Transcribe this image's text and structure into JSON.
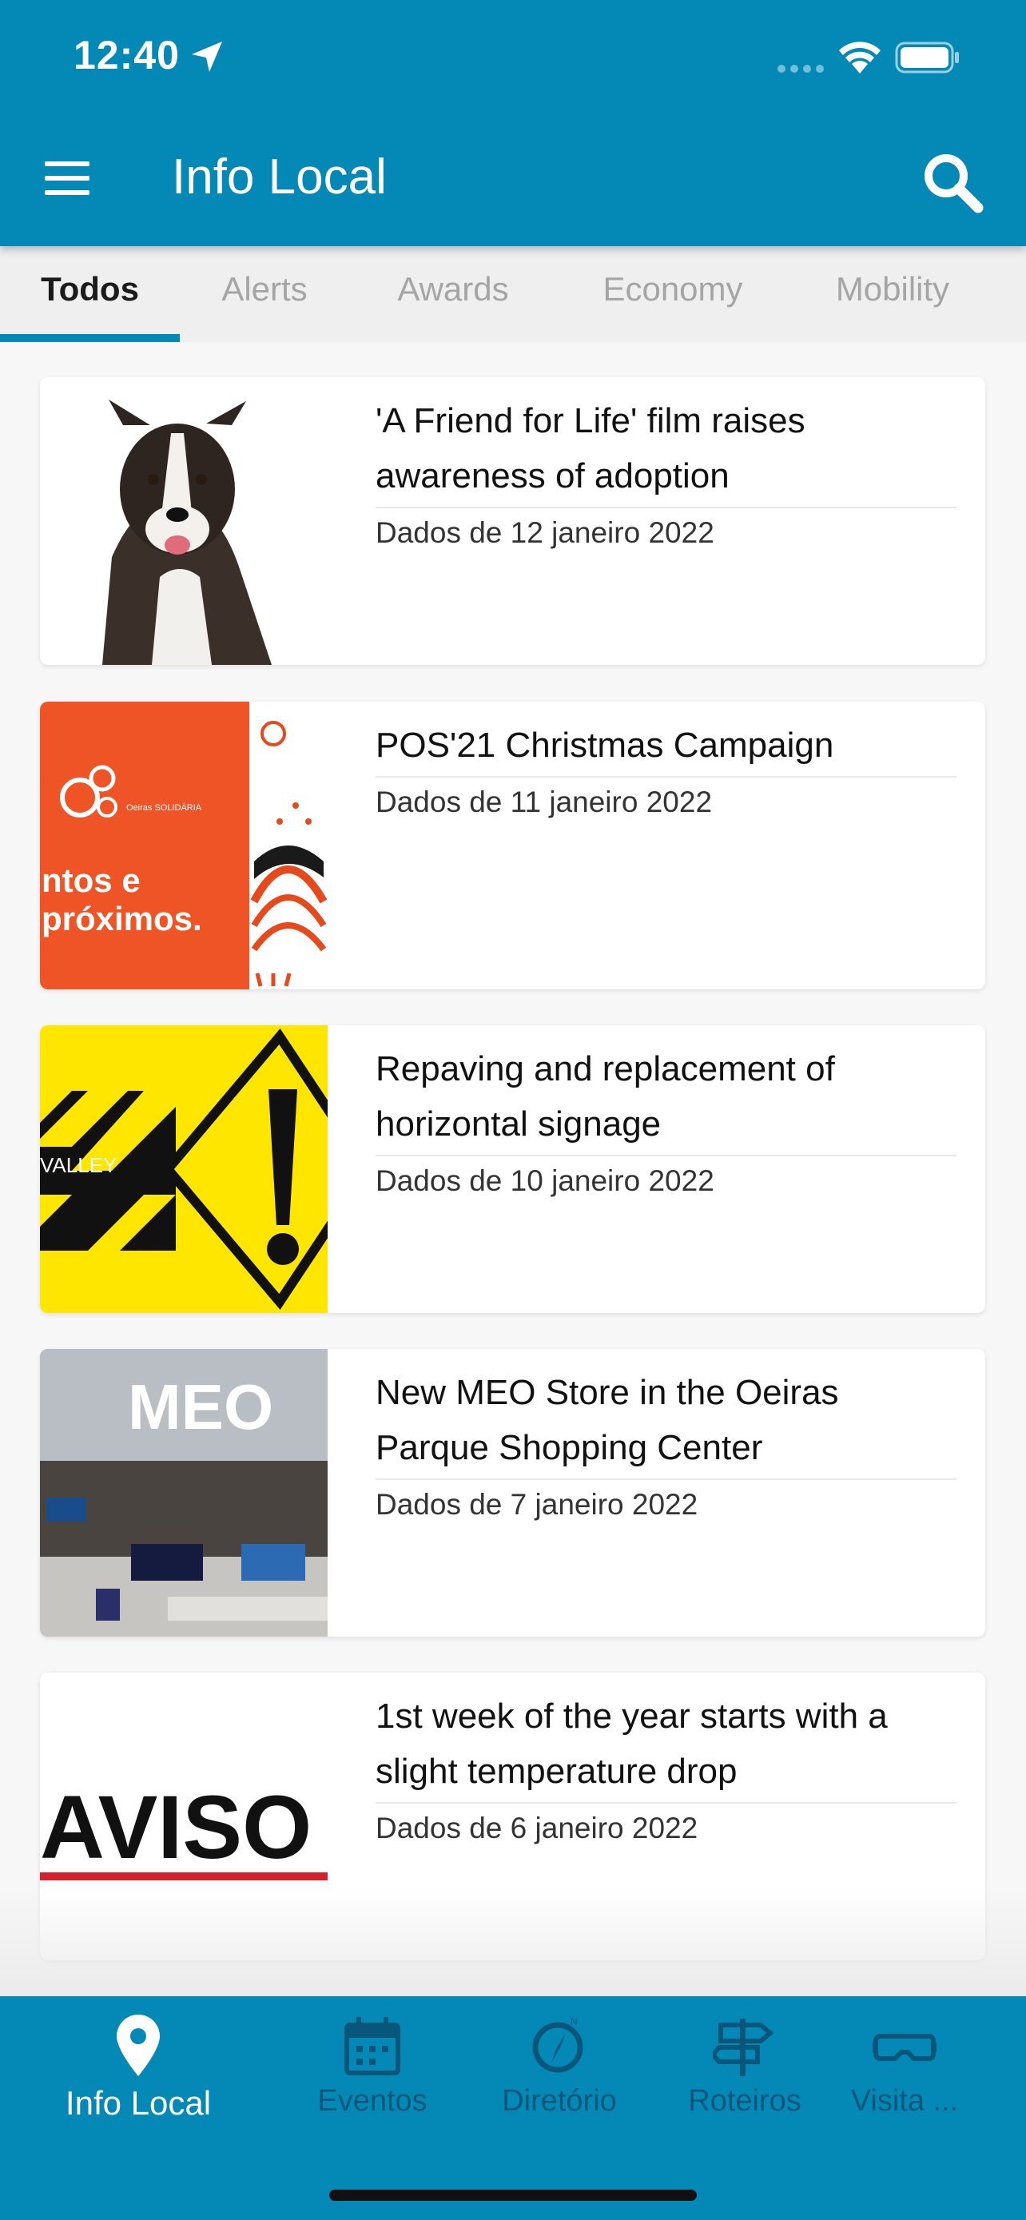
{
  "status_bar": {
    "time": "12:40"
  },
  "header": {
    "title": "Info Local"
  },
  "tabs": [
    {
      "label": "Todos",
      "active": true
    },
    {
      "label": "Alerts",
      "active": false
    },
    {
      "label": "Awards",
      "active": false
    },
    {
      "label": "Economy",
      "active": false
    },
    {
      "label": "Mobility",
      "active": false
    }
  ],
  "articles": [
    {
      "title": "'A Friend for Life' film raises awareness of adoption",
      "date": "Dados de 12 janeiro 2022"
    },
    {
      "title": "POS'21 Christmas Campaign",
      "date": "Dados de 11 janeiro 2022"
    },
    {
      "title": "Repaving and replacement of horizontal signage",
      "date": "Dados de 10 janeiro 2022"
    },
    {
      "title": "New MEO Store in the Oeiras Parque Shopping Center",
      "date": "Dados de 7 janeiro 2022"
    },
    {
      "title": "1st week of the year starts with a slight temperature drop",
      "date": "Dados de 6 janeiro 2022"
    }
  ],
  "thumbnails": {
    "christmas_lines": [
      "ntos e",
      "próximos."
    ],
    "christmas_logo": "Oeiras SOLIDÁRIA",
    "road_sign_brand": "VALLEY",
    "meo_sign": "MEO",
    "aviso": "AVISO"
  },
  "bottom_nav": [
    {
      "label": "Info Local",
      "icon": "map-pin-icon",
      "active": true
    },
    {
      "label": "Eventos",
      "icon": "calendar-icon",
      "active": false
    },
    {
      "label": "Diretório",
      "icon": "compass-icon",
      "active": false
    },
    {
      "label": "Roteiros",
      "icon": "signpost-icon",
      "active": false
    },
    {
      "label": "Visita ...",
      "icon": "vr-headset-icon",
      "active": false
    }
  ],
  "colors": {
    "primary": "#0489b7",
    "nav_inactive": "#08577a",
    "background": "#f7f7f7"
  }
}
